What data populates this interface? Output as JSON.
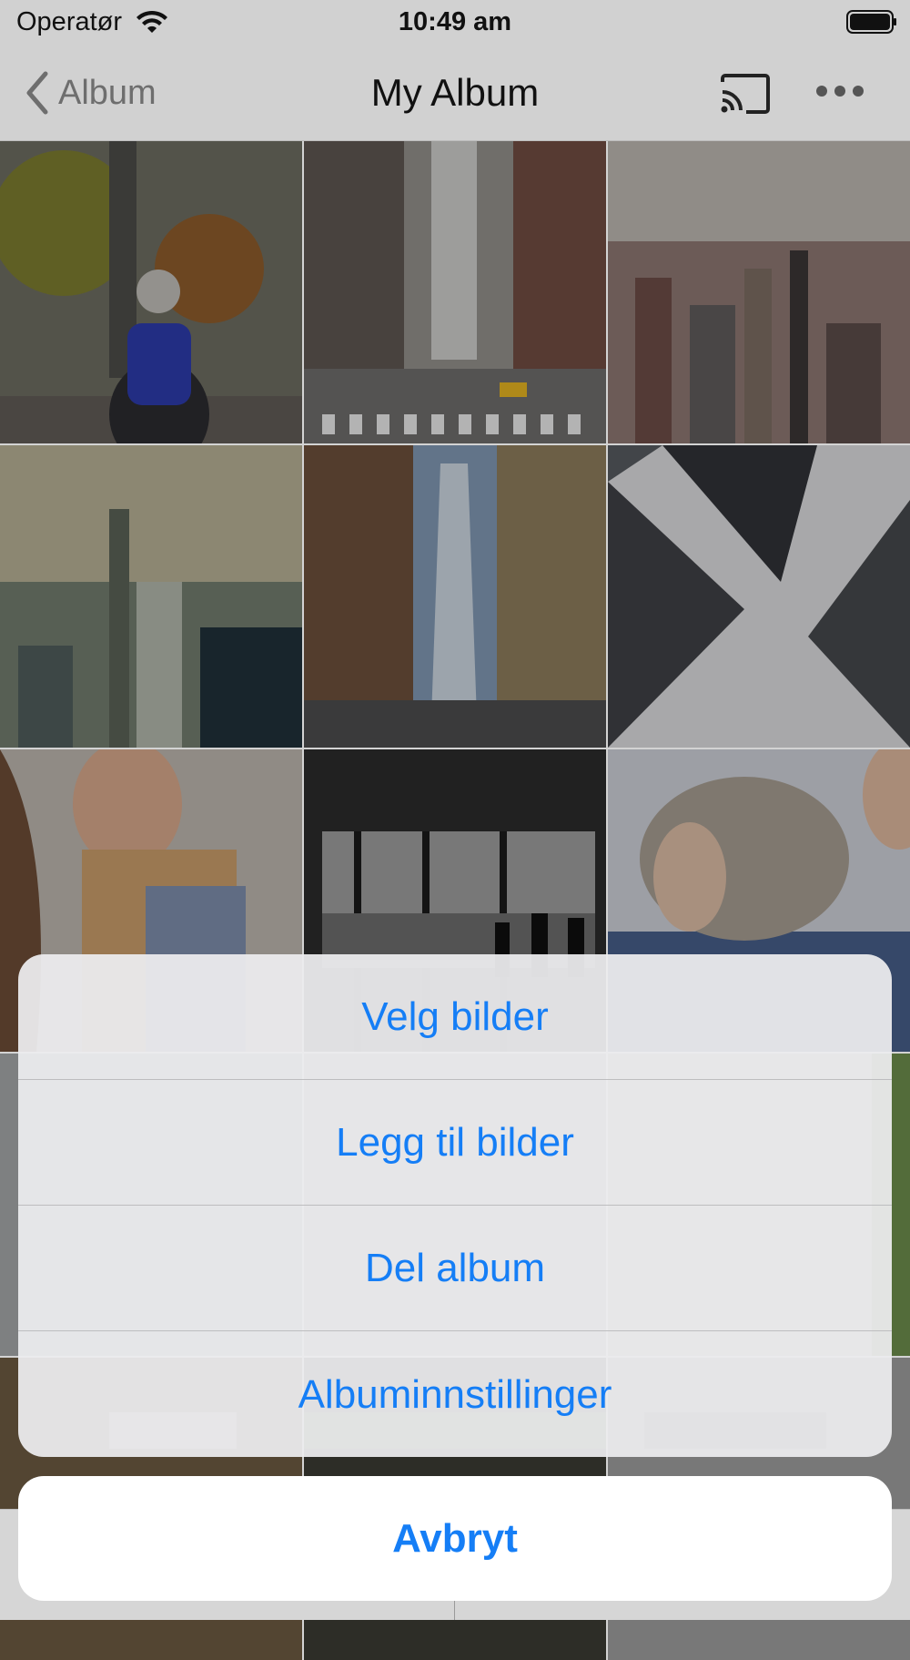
{
  "status_bar": {
    "carrier": "Operatør",
    "time": "10:49 am"
  },
  "nav_bar": {
    "back_label": "Album",
    "title": "My Album"
  },
  "action_sheet": {
    "options": [
      "Velg bilder",
      "Legg til bilder",
      "Del album",
      "Albuminnstillinger"
    ],
    "cancel_label": "Avbryt"
  },
  "colors": {
    "accent": "#157ef6"
  }
}
